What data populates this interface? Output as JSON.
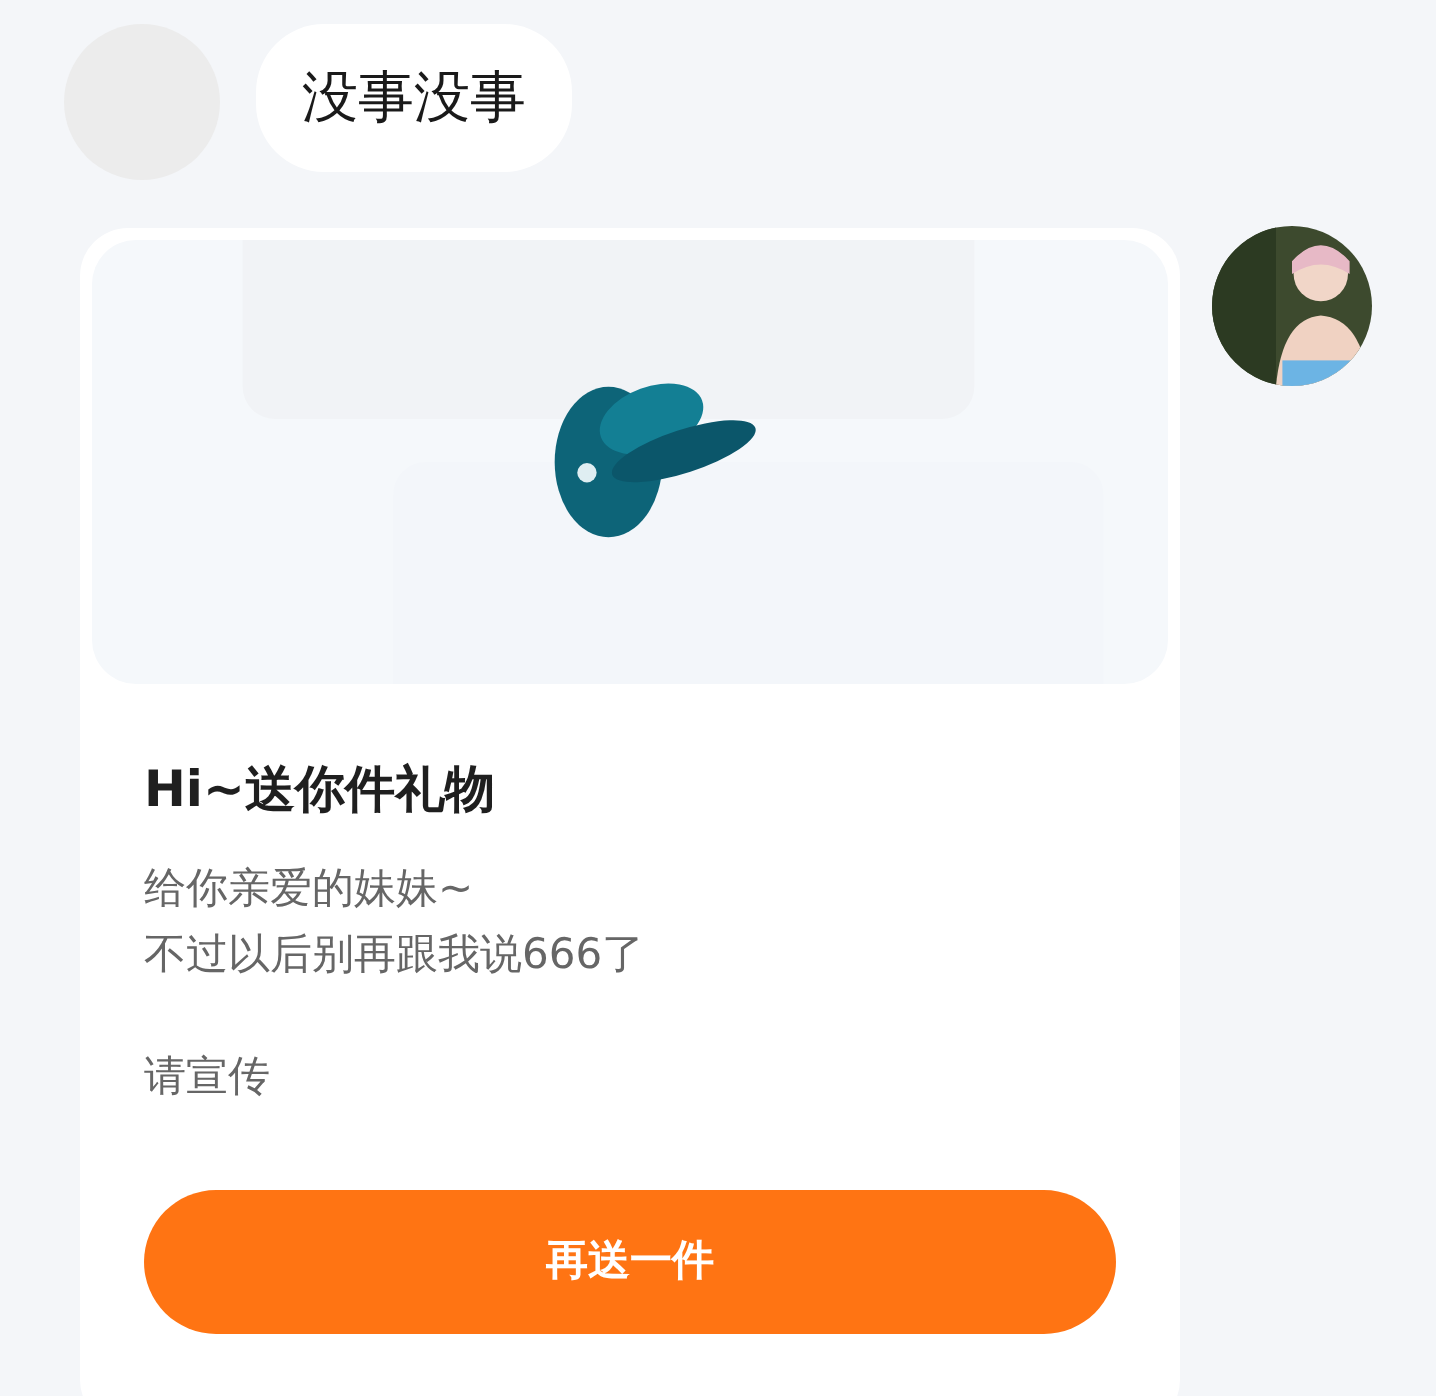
{
  "incoming_message": {
    "text": "没事没事"
  },
  "gift_card": {
    "title": "Hi~送你件礼物",
    "message_lines": [
      "给你亲爱的妹妹~",
      "不过以后别再跟我说666了"
    ],
    "note": "请宣传",
    "button": "再送一件"
  }
}
